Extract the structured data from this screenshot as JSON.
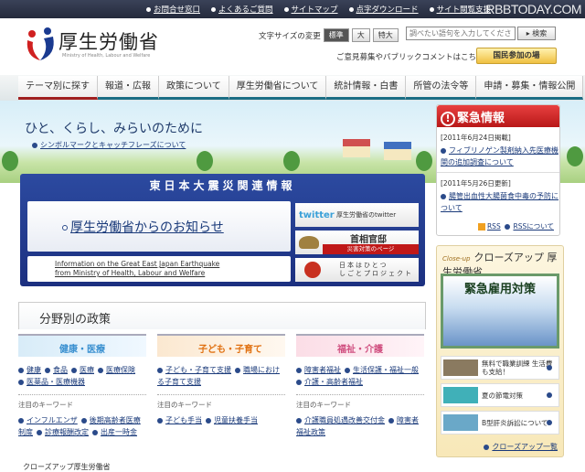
{
  "topbar": {
    "links": [
      "お問合せ窓口",
      "よくあるご質問",
      "サイトマップ",
      "点字ダウンロード",
      "サイト閲覧支援"
    ],
    "watermark": "RBBTODAY.COM"
  },
  "header": {
    "title": "厚生労働省",
    "subtitle": "Ministry of Health, Labour and Welfare",
    "font_size_label": "文字サイズの変更",
    "font_sizes": [
      "標準",
      "大",
      "特大"
    ],
    "search_placeholder": "調べたい語句を入力してください",
    "search_button": "検索",
    "opinion_text": "ご意見募集やパブリックコメントはこちら",
    "participation_button": "国民参加の場"
  },
  "nav": [
    "テーマ別に探す",
    "報道・広報",
    "政策について",
    "厚生労働省について",
    "統計情報・白書",
    "所管の法令等",
    "申請・募集・情報公開"
  ],
  "hero": {
    "catch": "ひと、くらし、みらいのために",
    "link": "シンボルマークとキャッチフレーズについて"
  },
  "earthquake": {
    "title": "東日本大震災関連情報",
    "main_link": "厚生労働省からのお知らせ",
    "english_line1": "Information on the Great East Japan Earthquake",
    "english_line2": "from Ministry of Health, Labour and Welfare",
    "twitter_logo": "twitter",
    "twitter_label": "厚生労働省のtwitter",
    "kantei_title": "首相官邸",
    "kantei_sub": "災害対策のページ",
    "project_line1": "日本はひとつ",
    "project_line2": "しごとプロジェクト"
  },
  "emergency": {
    "title": "緊急情報",
    "items": [
      {
        "date": "[2011年6月24日掲載]",
        "link": "フィブリノゲン製剤納入先医療機関の追加調査について"
      },
      {
        "date": "[2011年5月26日更新]",
        "link": "腸管出血性大腸菌食中毒の予防について"
      }
    ],
    "rss": "RSS",
    "rss_about": "RSSについて"
  },
  "policy": {
    "title": "分野別の政策",
    "columns": [
      {
        "heading": "健康・医療",
        "links": [
          "健康",
          "食品",
          "医療",
          "医療保険",
          "医薬品・医療機器"
        ],
        "keyword_label": "注目のキーワード",
        "keywords": [
          "インフルエンザ",
          "後期高齢者医療制度",
          "診療報酬改定",
          "出産一時金"
        ]
      },
      {
        "heading": "子ども・子育て",
        "links": [
          "子ども・子育て支援",
          "職場における子育て支援"
        ],
        "keyword_label": "注目のキーワード",
        "keywords": [
          "子ども手当",
          "児童扶養手当"
        ]
      },
      {
        "heading": "福祉・介護",
        "links": [
          "障害者福祉",
          "生活保護・福祉一般",
          "介護・高齢者福祉"
        ],
        "keyword_label": "注目のキーワード",
        "keywords": [
          "介護職員処遇改善交付金",
          "障害者福祉政策"
        ]
      }
    ]
  },
  "bottom_text": "クローズアップ厚生労働省",
  "closeup": {
    "tag": "Close-up",
    "title": "クローズアップ 厚生労働省",
    "banner": "緊急雇用対策",
    "items": [
      "無料で職業訓練 生活費も支給！",
      "夏の節電対策",
      "B型肝炎訴訟について"
    ],
    "more": "クローズアップ一覧"
  },
  "colors": {
    "nav_accent": "#1b6d84",
    "emergency_red": "#c82020",
    "earthquake_blue": "#1c3080"
  }
}
